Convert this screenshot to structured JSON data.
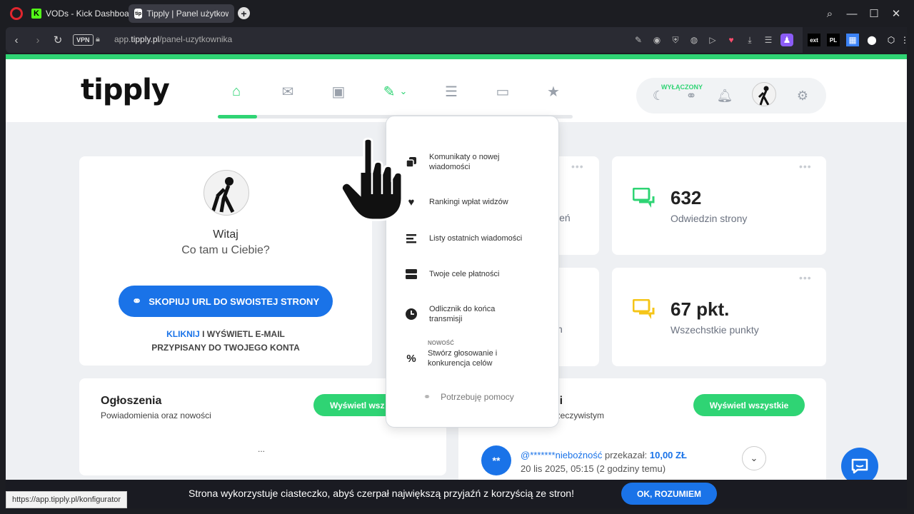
{
  "browser": {
    "tabs": [
      {
        "title": "VODs - Kick Dashboard"
      },
      {
        "title": "Tipply | Panel użytkownika"
      }
    ],
    "vpn_label": "VPN",
    "url_prefix": "app.",
    "url_domain": "tipply.pl",
    "url_path": "/panel-uzytkownika",
    "status_url": "https://app.tipply.pl/konfigurator",
    "ext_labels": [
      "ext",
      "PL"
    ]
  },
  "header": {
    "logo": "tipply",
    "off_label": "WYŁĄCZONY"
  },
  "profile_card": {
    "greeting": "Witaj",
    "subtitle": "Co tam u Ciebie?",
    "copy_button": "SKOPIUJ URL DO SWOISTEJ STRONY",
    "email_link": "KLIKNIJ",
    "email_text": " I WYŚWIETL E-MAIL",
    "email_text2": "PRZYPISANY DO TWOJEGO KONTA"
  },
  "stats": [
    {
      "value": "632",
      "label": "Odwiedzin strony",
      "icon_color": "#2fd474"
    },
    {
      "value": "67 pkt.",
      "label": "Wszechstkie punkty",
      "icon_color": "#f5c518"
    }
  ],
  "partial_stats": {
    "top_frag": "ień",
    "bottom_frag": "h"
  },
  "announcements": {
    "title": "Ogłoszenia",
    "subtitle": "Powiadomienia oraz nowości",
    "button": "Wyświetl wsz",
    "placeholder": "..."
  },
  "tips": {
    "title_frag": "ości",
    "subtitle_frag": "sie rzeczywistym",
    "button": "Wyświetl wszystkie",
    "item": {
      "avatar": "**",
      "user": "@*******nieboźność",
      "action": " przekazał: ",
      "amount": "10,00 ZŁ",
      "time": "20 lis 2025, 05:15 (2 godziny temu)"
    }
  },
  "dropdown": {
    "items": [
      {
        "label": "Komunikaty o nowej wiadomości",
        "icon": "copy-icon"
      },
      {
        "label": "Rankingi wpłat widzów",
        "icon": "heart-icon"
      },
      {
        "label": "Listy ostatnich wiadomości",
        "icon": "list-icon"
      },
      {
        "label": "Twoje cele płatności",
        "icon": "goal-icon"
      },
      {
        "label": "Odlicznik do końca transmisji",
        "icon": "clock-icon"
      },
      {
        "label": "Stwórz głosowanie i konkurencja celów",
        "icon": "percent-icon",
        "badge": "NOWOŚĆ"
      }
    ],
    "help": "Potrzebuję pomocy"
  },
  "cookie": {
    "text": "Strona wykorzystuje ciasteczko, abyś czerpał największą przyjaźń z korzyścią ze stron!",
    "button": "OK, ROZUMIEM"
  },
  "colors": {
    "accent": "#2fd474",
    "link": "#1a73e8"
  }
}
